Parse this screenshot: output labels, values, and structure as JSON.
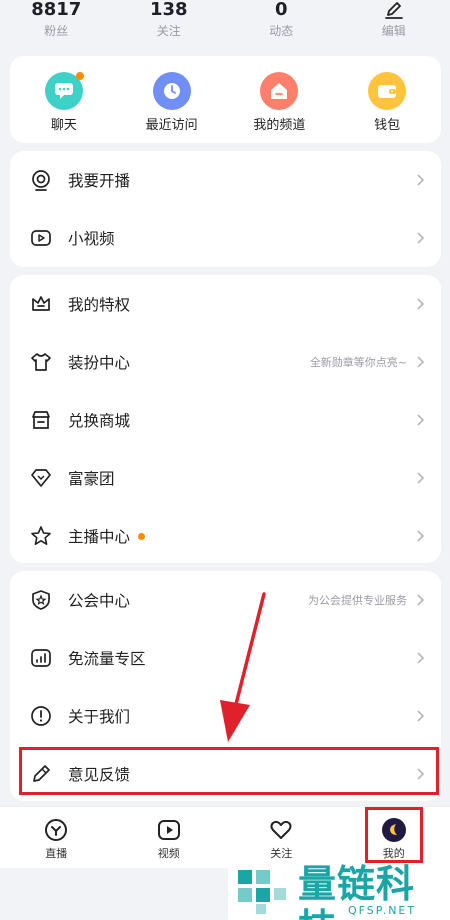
{
  "stats": [
    {
      "value": "8817",
      "label": "粉丝"
    },
    {
      "value": "138",
      "label": "关注"
    },
    {
      "value": "0",
      "label": "动态"
    },
    {
      "label": "编辑"
    }
  ],
  "quick": [
    {
      "label": "聊天",
      "icon": "chat-bubble-icon",
      "color": "#3fd1c8"
    },
    {
      "label": "最近访问",
      "icon": "clock-icon",
      "color": "#6f8ff5"
    },
    {
      "label": "我的频道",
      "icon": "house-icon",
      "color": "#ff7f6b"
    },
    {
      "label": "钱包",
      "icon": "wallet-icon",
      "color": "#ffc33d"
    }
  ],
  "group1": [
    {
      "label": "我要开播",
      "icon": "broadcast-icon"
    },
    {
      "label": "小视频",
      "icon": "video-icon"
    }
  ],
  "group2": [
    {
      "label": "我的特权",
      "icon": "crown-icon"
    },
    {
      "label": "装扮中心",
      "icon": "tshirt-icon",
      "sub": "全新勋章等你点亮~"
    },
    {
      "label": "兑换商城",
      "icon": "store-icon"
    },
    {
      "label": "富豪团",
      "icon": "diamond-icon"
    },
    {
      "label": "主播中心",
      "icon": "star-icon"
    }
  ],
  "group3": [
    {
      "label": "公会中心",
      "icon": "guild-shield-icon",
      "sub": "为公会提供专业服务"
    },
    {
      "label": "免流量专区",
      "icon": "data-bars-icon"
    },
    {
      "label": "关于我们",
      "icon": "info-icon"
    },
    {
      "label": "意见反馈",
      "icon": "pencil-icon"
    }
  ],
  "nav": [
    {
      "label": "直播",
      "icon": "live-icon"
    },
    {
      "label": "视频",
      "icon": "play-icon"
    },
    {
      "label": "关注",
      "icon": "heart-icon"
    },
    {
      "label": "我的",
      "icon": "avatar-icon"
    }
  ],
  "watermark": {
    "text": "量链科技",
    "url": "QFSP.NET"
  },
  "colors": {
    "accent": "#ff8a00",
    "annotation": "#e0202a",
    "watermark": "#1aa6a6"
  }
}
